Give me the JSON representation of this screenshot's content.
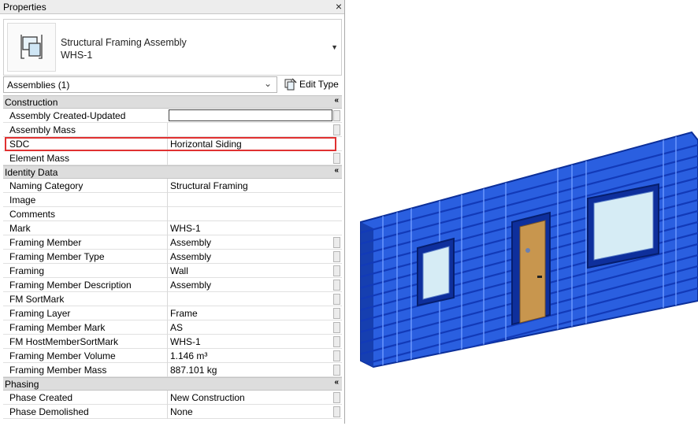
{
  "panel": {
    "title": "Properties",
    "close_label": "×"
  },
  "type_selector": {
    "line1": "Structural Framing Assembly",
    "line2": "WHS-1"
  },
  "filter": {
    "value": "Assemblies (1)",
    "edit_type_label": "Edit Type"
  },
  "groups": {
    "construction": {
      "label": "Construction",
      "rows": [
        {
          "name": "Assembly Created-Updated",
          "value": ""
        },
        {
          "name": "Assembly Mass",
          "value": ""
        },
        {
          "name": "SDC",
          "value": "Horizontal Siding"
        },
        {
          "name": "Element Mass",
          "value": ""
        }
      ]
    },
    "identity": {
      "label": "Identity Data",
      "rows": [
        {
          "name": "Naming Category",
          "value": "Structural Framing"
        },
        {
          "name": "Image",
          "value": ""
        },
        {
          "name": "Comments",
          "value": ""
        },
        {
          "name": "Mark",
          "value": "WHS-1"
        },
        {
          "name": "Framing Member",
          "value": "Assembly"
        },
        {
          "name": "Framing Member Type",
          "value": "Assembly"
        },
        {
          "name": "Framing",
          "value": "Wall"
        },
        {
          "name": "Framing Member Description",
          "value": "Assembly"
        },
        {
          "name": "FM SortMark",
          "value": ""
        },
        {
          "name": "Framing Layer",
          "value": "Frame"
        },
        {
          "name": "Framing Member Mark",
          "value": "AS"
        },
        {
          "name": "FM HostMemberSortMark",
          "value": "WHS-1"
        },
        {
          "name": "Framing Member Volume",
          "value": "1.146 m³"
        },
        {
          "name": "Framing Member Mass",
          "value": "887.101 kg"
        }
      ]
    },
    "phasing": {
      "label": "Phasing",
      "rows": [
        {
          "name": "Phase Created",
          "value": "New Construction"
        },
        {
          "name": "Phase Demolished",
          "value": "None"
        }
      ]
    }
  },
  "colors": {
    "wall_blue": "#1a4fd6",
    "highlight_red": "#e03131",
    "door_tan": "#c8964e",
    "glass": "#d6ecf5"
  }
}
